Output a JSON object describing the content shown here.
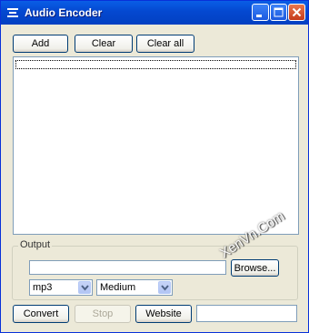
{
  "window": {
    "title": "Audio Encoder"
  },
  "toolbar": {
    "add_label": "Add",
    "clear_label": "Clear",
    "clear_all_label": "Clear all"
  },
  "output": {
    "group_label": "Output",
    "path_value": "",
    "browse_label": "Browse...",
    "format_selected": "mp3",
    "quality_selected": "Medium"
  },
  "footer": {
    "convert_label": "Convert",
    "stop_label": "Stop",
    "website_label": "Website",
    "status_value": ""
  },
  "watermark": {
    "text": "XenVn.Com"
  },
  "colors": {
    "titlebar": "#0448d0",
    "window_bg": "#ece9d8",
    "close_button": "#c53b1c",
    "button_border": "#003c74"
  }
}
